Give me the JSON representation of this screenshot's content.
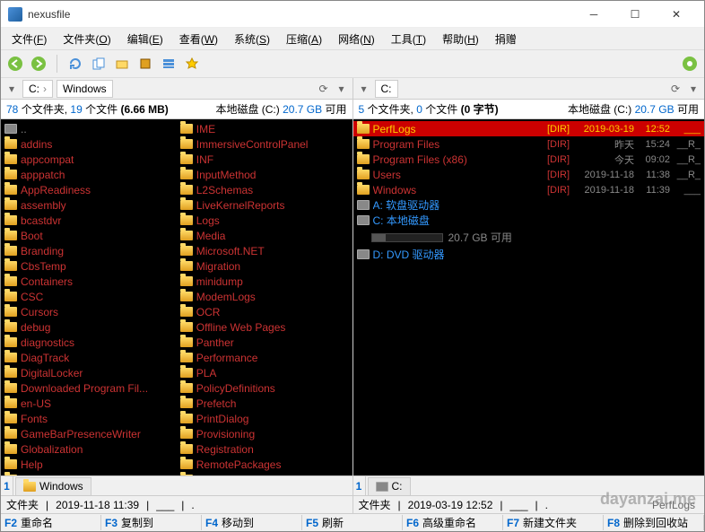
{
  "app": {
    "title": "nexusfile"
  },
  "menu": [
    {
      "label": "文件",
      "key": "F"
    },
    {
      "label": "文件夹",
      "key": "O"
    },
    {
      "label": "编辑",
      "key": "E"
    },
    {
      "label": "查看",
      "key": "W"
    },
    {
      "label": "系统",
      "key": "S"
    },
    {
      "label": "压缩",
      "key": "A"
    },
    {
      "label": "网络",
      "key": "N"
    },
    {
      "label": "工具",
      "key": "T"
    },
    {
      "label": "帮助",
      "key": "H"
    },
    {
      "label": "捐赠",
      "key": ""
    }
  ],
  "left": {
    "breadcrumb": [
      "C:",
      "Windows"
    ],
    "summary": {
      "folders_n": "78",
      "folders_l": "个文件夹,",
      "files_n": "19",
      "files_l": "个文件",
      "size": "(6.66 MB)",
      "disk": "本地磁盘 (C:)",
      "free_n": "20.7 GB",
      "free_l": "可用"
    },
    "tab_num": "1",
    "col1": [
      {
        "name": "..",
        "parent": true
      },
      {
        "name": "addins"
      },
      {
        "name": "appcompat"
      },
      {
        "name": "apppatch"
      },
      {
        "name": "AppReadiness"
      },
      {
        "name": "assembly"
      },
      {
        "name": "bcastdvr"
      },
      {
        "name": "Boot"
      },
      {
        "name": "Branding"
      },
      {
        "name": "CbsTemp"
      },
      {
        "name": "Containers"
      },
      {
        "name": "CSC"
      },
      {
        "name": "Cursors"
      },
      {
        "name": "debug"
      },
      {
        "name": "diagnostics"
      },
      {
        "name": "DiagTrack"
      },
      {
        "name": "DigitalLocker"
      },
      {
        "name": "Downloaded Program Fil..."
      },
      {
        "name": "en-US"
      },
      {
        "name": "Fonts"
      },
      {
        "name": "GameBarPresenceWriter"
      },
      {
        "name": "Globalization"
      },
      {
        "name": "Help"
      },
      {
        "name": "IdentityCRL"
      }
    ],
    "col2": [
      {
        "name": "IME"
      },
      {
        "name": "ImmersiveControlPanel"
      },
      {
        "name": "INF"
      },
      {
        "name": "InputMethod"
      },
      {
        "name": "L2Schemas"
      },
      {
        "name": "LiveKernelReports"
      },
      {
        "name": "Logs"
      },
      {
        "name": "Media"
      },
      {
        "name": "Microsoft.NET"
      },
      {
        "name": "Migration"
      },
      {
        "name": "minidump"
      },
      {
        "name": "ModemLogs"
      },
      {
        "name": "OCR"
      },
      {
        "name": "Offline Web Pages"
      },
      {
        "name": "Panther"
      },
      {
        "name": "Performance"
      },
      {
        "name": "PLA"
      },
      {
        "name": "PolicyDefinitions"
      },
      {
        "name": "Prefetch"
      },
      {
        "name": "PrintDialog"
      },
      {
        "name": "Provisioning"
      },
      {
        "name": "Registration"
      },
      {
        "name": "RemotePackages"
      },
      {
        "name": "rescache"
      }
    ],
    "status": {
      "type": "文件夹",
      "date": "2019-11-18 11:39",
      "attr": "___",
      "sep": "."
    }
  },
  "right": {
    "breadcrumb": [
      "C:"
    ],
    "summary": {
      "folders_n": "5",
      "folders_l": "个文件夹,",
      "files_n": "0",
      "files_l": "个文件",
      "size": "(0 字节)",
      "disk": "本地磁盘 (C:)",
      "free_n": "20.7 GB",
      "free_l": "可用"
    },
    "tab_num": "1",
    "items": [
      {
        "name": "PerfLogs",
        "dir": "[DIR]",
        "date": "2019-03-19",
        "time": "12:52",
        "attr": "___",
        "selected": true
      },
      {
        "name": "Program Files",
        "dir": "[DIR]",
        "date": "昨天",
        "time": "15:24",
        "attr": "__R_"
      },
      {
        "name": "Program Files (x86)",
        "dir": "[DIR]",
        "date": "今天",
        "time": "09:02",
        "attr": "__R_"
      },
      {
        "name": "Users",
        "dir": "[DIR]",
        "date": "2019-11-18",
        "time": "11:38",
        "attr": "__R_"
      },
      {
        "name": "Windows",
        "dir": "[DIR]",
        "date": "2019-11-18",
        "time": "11:39",
        "attr": "___"
      }
    ],
    "drives": [
      {
        "name": "A: 软盘驱动器"
      },
      {
        "name": "C: 本地磁盘",
        "bar": 20,
        "free": "20.7 GB 可用"
      },
      {
        "name": "D: DVD 驱动器"
      }
    ],
    "status": {
      "type": "文件夹",
      "date": "2019-03-19 12:52",
      "attr": "___",
      "sep": ".",
      "extra": "PerfLogs"
    }
  },
  "fkeys": [
    {
      "fn": "F2",
      "label": "重命名"
    },
    {
      "fn": "F3",
      "label": "复制到"
    },
    {
      "fn": "F4",
      "label": "移动到"
    },
    {
      "fn": "F5",
      "label": "刷新"
    },
    {
      "fn": "F6",
      "label": "高级重命名"
    },
    {
      "fn": "F7",
      "label": "新建文件夹"
    },
    {
      "fn": "F8",
      "label": "删除到回收站"
    }
  ],
  "watermark": "dayanzai.me"
}
